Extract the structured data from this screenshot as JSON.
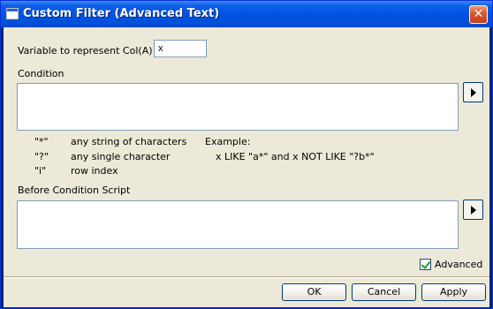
{
  "window": {
    "title": "Custom Filter (Advanced Text)"
  },
  "variable": {
    "label": "Variable to represent Col(A)",
    "value": "x"
  },
  "condition": {
    "label": "Condition",
    "value": ""
  },
  "legend": [
    {
      "symbol": "\"*\"",
      "desc": "any string of characters"
    },
    {
      "symbol": "\"?\"",
      "desc": "any single character"
    },
    {
      "symbol": "\"i\"",
      "desc": "row index"
    }
  ],
  "example": {
    "label": "Example:",
    "text": "x LIKE \"a*\" and x NOT LIKE \"?b*\""
  },
  "script": {
    "label": "Before Condition Script",
    "value": ""
  },
  "advanced": {
    "label": "Advanced",
    "checked": true
  },
  "buttons": {
    "ok": "OK",
    "cancel": "Cancel",
    "apply": "Apply"
  }
}
